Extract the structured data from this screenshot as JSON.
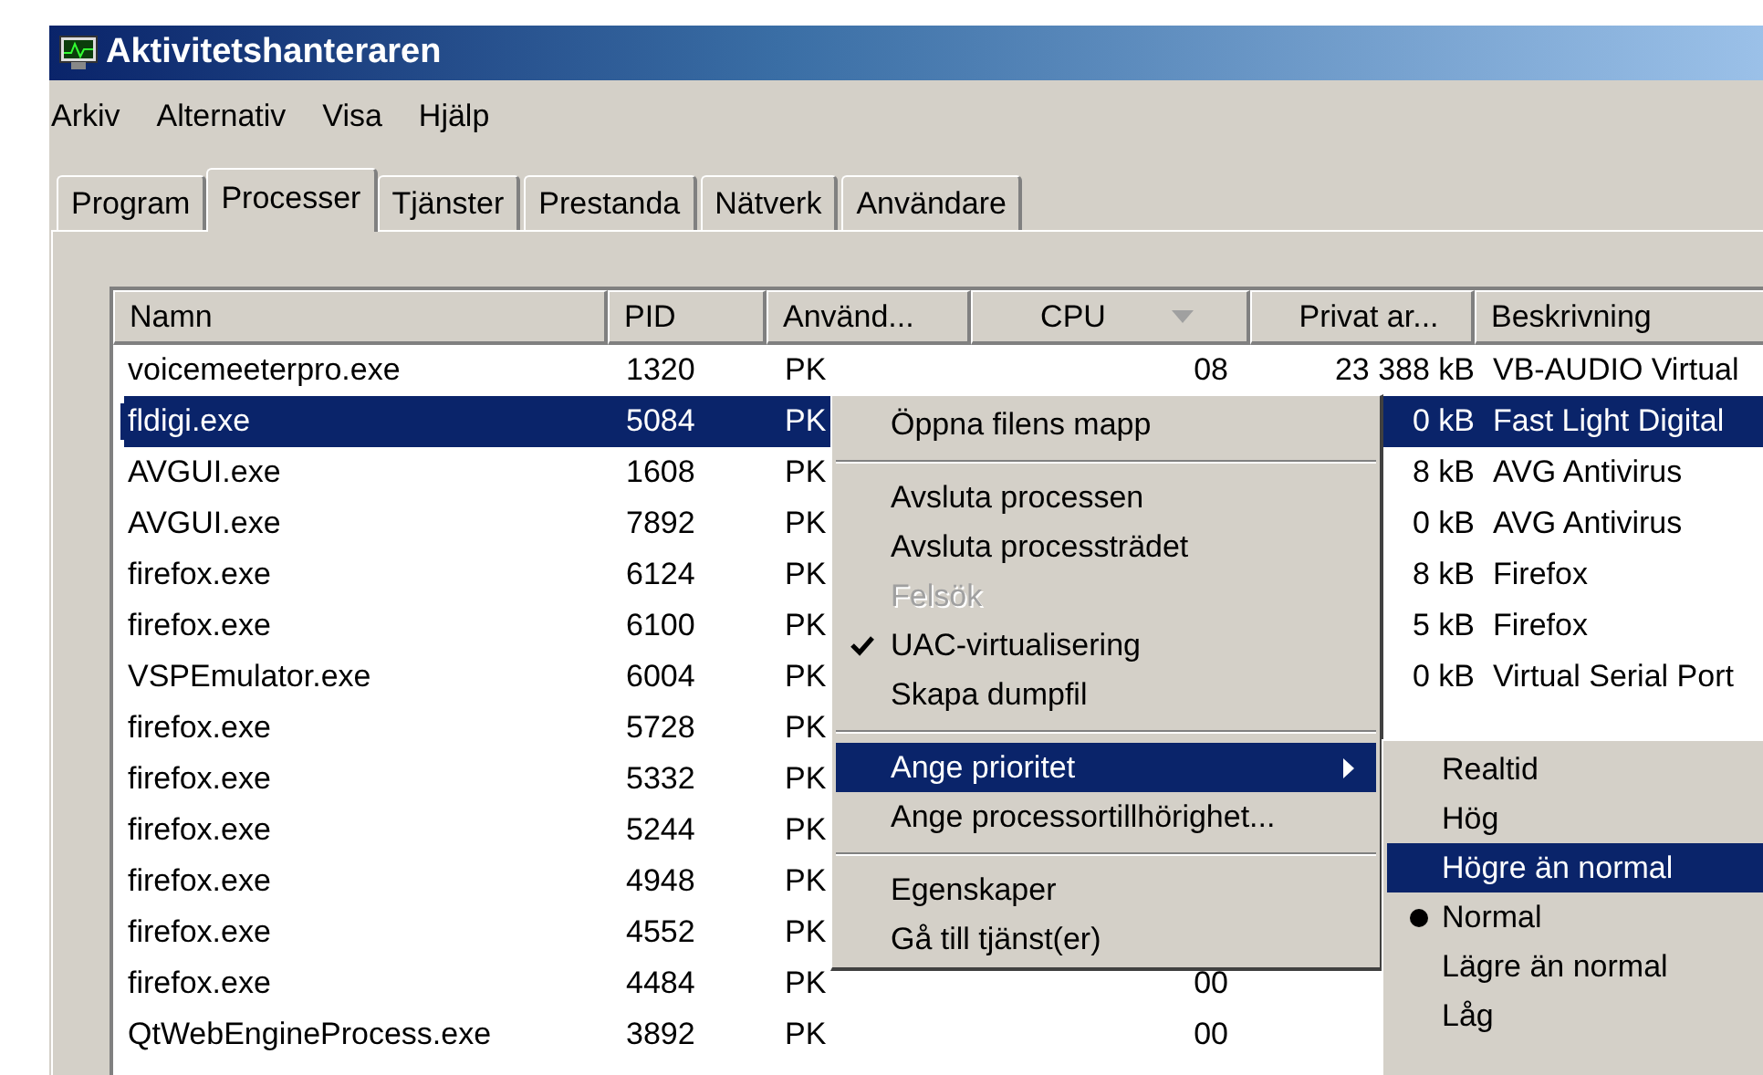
{
  "window": {
    "title": "Aktivitetshanteraren"
  },
  "menu_bar": [
    "Arkiv",
    "Alternativ",
    "Visa",
    "Hjälp"
  ],
  "tabs": [
    {
      "label": "Program",
      "selected": false
    },
    {
      "label": "Processer",
      "selected": true
    },
    {
      "label": "Tjänster",
      "selected": false
    },
    {
      "label": "Prestanda",
      "selected": false
    },
    {
      "label": "Nätverk",
      "selected": false
    },
    {
      "label": "Användare",
      "selected": false
    }
  ],
  "table": {
    "columns": [
      {
        "label": "Namn",
        "sorted": false
      },
      {
        "label": "PID",
        "sorted": false
      },
      {
        "label": "Använd...",
        "sorted": false
      },
      {
        "label": "CPU",
        "sorted": true
      },
      {
        "label": "Privat ar...",
        "sorted": false
      },
      {
        "label": "Beskrivning",
        "sorted": false
      }
    ],
    "rows": [
      {
        "selected": false,
        "name": "voicemeeterpro.exe",
        "pid": "1320",
        "user": "PK",
        "cpu": "08",
        "memory": "23 388 kB",
        "description": "VB-AUDIO Virtual"
      },
      {
        "selected": true,
        "name": "fldigi.exe",
        "pid": "5084",
        "user": "PK",
        "memory": "0 kB",
        "description": "Fast Light Digital"
      },
      {
        "selected": false,
        "name": "AVGUI.exe",
        "pid": "1608",
        "user": "PK",
        "memory": "8 kB",
        "description": "AVG Antivirus"
      },
      {
        "selected": false,
        "name": "AVGUI.exe",
        "pid": "7892",
        "user": "PK",
        "memory": "0 kB",
        "description": "AVG Antivirus"
      },
      {
        "selected": false,
        "name": "firefox.exe",
        "pid": "6124",
        "user": "PK",
        "memory": "8 kB",
        "description": "Firefox"
      },
      {
        "selected": false,
        "name": "firefox.exe",
        "pid": "6100",
        "user": "PK",
        "memory": "5 kB",
        "description": "Firefox"
      },
      {
        "selected": false,
        "name": "VSPEmulator.exe",
        "pid": "6004",
        "user": "PK",
        "memory": "0 kB",
        "description": "Virtual Serial Port"
      },
      {
        "selected": false,
        "name": "firefox.exe",
        "pid": "5728",
        "user": "PK"
      },
      {
        "selected": false,
        "name": "firefox.exe",
        "pid": "5332",
        "user": "PK"
      },
      {
        "selected": false,
        "name": "firefox.exe",
        "pid": "5244",
        "user": "PK"
      },
      {
        "selected": false,
        "name": "firefox.exe",
        "pid": "4948",
        "user": "PK"
      },
      {
        "selected": false,
        "name": "firefox.exe",
        "pid": "4552",
        "user": "PK"
      },
      {
        "selected": false,
        "name": "firefox.exe",
        "pid": "4484",
        "user": "PK",
        "cpu": "00"
      },
      {
        "selected": false,
        "name": "QtWebEngineProcess.exe",
        "pid": "3892",
        "user": "PK",
        "cpu": "00"
      }
    ]
  },
  "context_menu": {
    "items": [
      {
        "kind": "item",
        "label": "Öppna filens mapp",
        "disabled": false,
        "checked": false,
        "highlighted": false,
        "submenu": false
      },
      {
        "kind": "separator"
      },
      {
        "kind": "item",
        "label": "Avsluta processen",
        "disabled": false,
        "checked": false,
        "highlighted": false,
        "submenu": false
      },
      {
        "kind": "item",
        "label": "Avsluta processträdet",
        "disabled": false,
        "checked": false,
        "highlighted": false,
        "submenu": false
      },
      {
        "kind": "item",
        "label": "Felsök",
        "disabled": true,
        "checked": false,
        "highlighted": false,
        "submenu": false
      },
      {
        "kind": "item",
        "label": "UAC-virtualisering",
        "disabled": false,
        "checked": true,
        "highlighted": false,
        "submenu": false
      },
      {
        "kind": "item",
        "label": "Skapa dumpfil",
        "disabled": false,
        "checked": false,
        "highlighted": false,
        "submenu": false
      },
      {
        "kind": "separator"
      },
      {
        "kind": "item",
        "label": "Ange prioritet",
        "disabled": false,
        "checked": false,
        "highlighted": true,
        "submenu": true
      },
      {
        "kind": "item",
        "label": "Ange processortillhörighet...",
        "disabled": false,
        "checked": false,
        "highlighted": false,
        "submenu": false
      },
      {
        "kind": "separator"
      },
      {
        "kind": "item",
        "label": "Egenskaper",
        "disabled": false,
        "checked": false,
        "highlighted": false,
        "submenu": false
      },
      {
        "kind": "item",
        "label": "Gå till tjänst(er)",
        "disabled": false,
        "checked": false,
        "highlighted": false,
        "submenu": false
      }
    ]
  },
  "submenu": {
    "items": [
      {
        "label": "Realtid",
        "selected": false,
        "highlighted": false
      },
      {
        "label": "Hög",
        "selected": false,
        "highlighted": false
      },
      {
        "label": "Högre än normal",
        "selected": false,
        "highlighted": true
      },
      {
        "label": "Normal",
        "selected": true,
        "highlighted": false
      },
      {
        "label": "Lägre än normal",
        "selected": false,
        "highlighted": false
      },
      {
        "label": "Låg",
        "selected": false,
        "highlighted": false
      }
    ]
  }
}
